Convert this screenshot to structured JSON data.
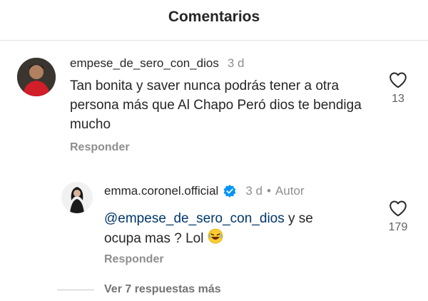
{
  "header": {
    "title": "Comentarios"
  },
  "comments": [
    {
      "username": "empese_de_sero_con_dios",
      "time": "3 d",
      "text": "Tan bonita y saver nunca podrás tener a otra persona más que Al Chapo Peró dios te bendiga mucho",
      "reply_label": "Responder",
      "likes": "13"
    }
  ],
  "reply": {
    "username": "emma.coronel.official",
    "verified": true,
    "time": "3 d",
    "author_badge": "Autor",
    "mention": "@empese_de_sero_con_dios",
    "text_rest": " y se ocupa mas ? Lol",
    "emoji": "🤣",
    "reply_label": "Responder",
    "likes": "179"
  },
  "view_more": {
    "label": "Ver 7 respuestas más"
  },
  "colors": {
    "text": "#262626",
    "secondary": "#8e8e8e",
    "mention": "#00376b",
    "verified": "#0095f6"
  }
}
